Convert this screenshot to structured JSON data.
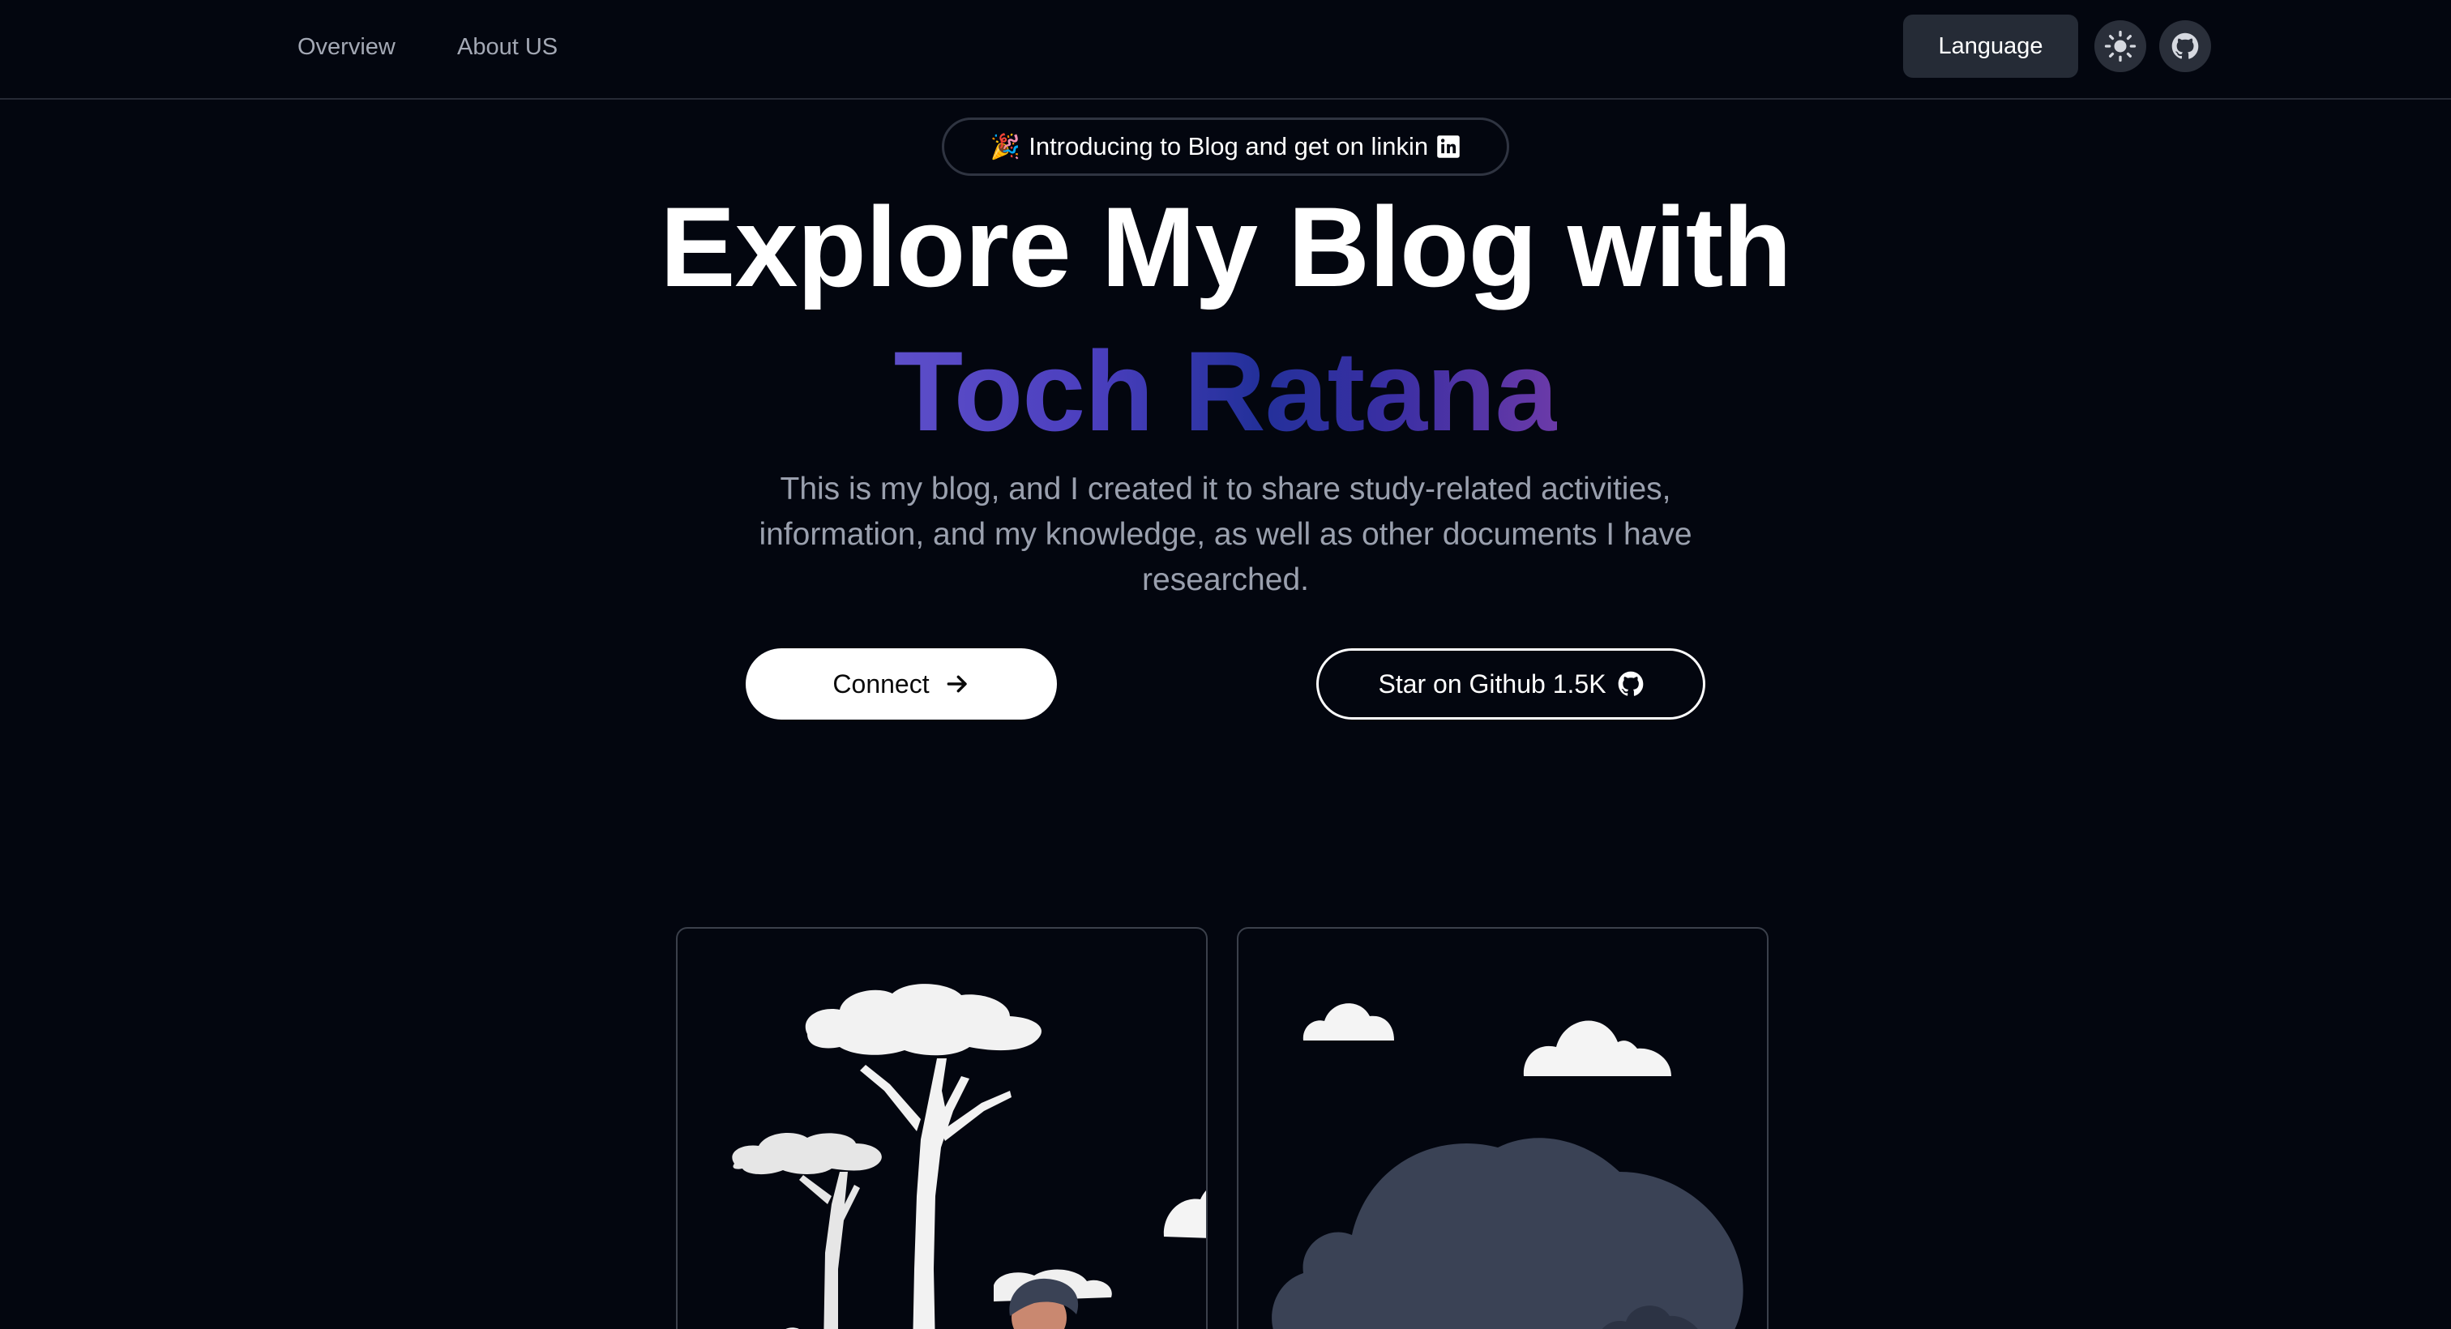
{
  "nav": {
    "links": [
      "Overview",
      "About US"
    ],
    "language_label": "Language",
    "theme_icon": "sun-icon",
    "github_icon": "github-icon"
  },
  "badge": {
    "emoji": "🎉",
    "text": "Introducing to Blog and get on linkin",
    "icon": "linkedin-icon"
  },
  "hero": {
    "title_line1": "Explore My Blog with",
    "title_line2": "Toch Ratana",
    "description": "This is my blog, and I created it to share study-related activities, information, and my knowledge, as well as other documents I have researched."
  },
  "buttons": {
    "connect_label": "Connect",
    "star_label": "Star on Github 1.5K"
  },
  "colors": {
    "background": "#03060f",
    "gradient_start": "#5d4ec9",
    "gradient_mid": "#23309a",
    "gradient_end": "#6b3aa8",
    "cloud_dark": "#3a4255"
  }
}
